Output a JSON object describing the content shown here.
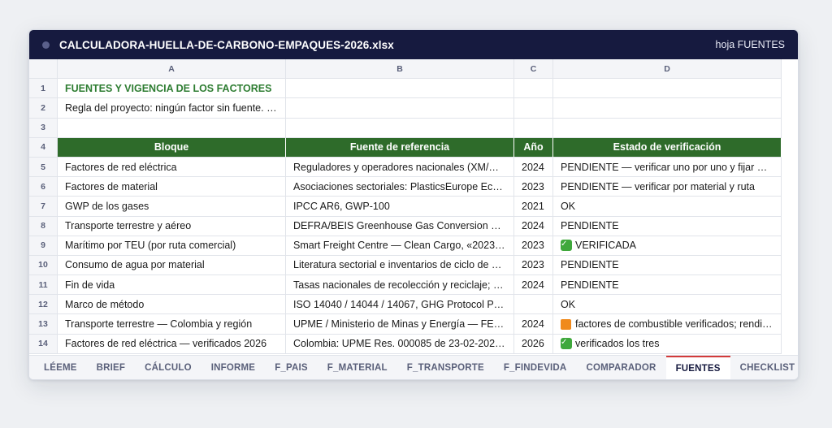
{
  "window": {
    "title": "CALCULADORA-HUELLA-DE-CARBONO-EMPAQUES-2026.xlsx",
    "sheet_label": "hoja FUENTES"
  },
  "columns": [
    "A",
    "B",
    "C",
    "D"
  ],
  "row_numbers": [
    "1",
    "2",
    "3",
    "4",
    "5",
    "6",
    "7",
    "8",
    "9",
    "10",
    "11",
    "12",
    "13",
    "14"
  ],
  "sheet_title": "FUENTES Y VIGENCIA DE LOS FACTORES",
  "project_rule": "Regla del proyecto: ningún factor sin fuente. …",
  "headers": {
    "bloque": "Bloque",
    "fuente": "Fuente de referencia",
    "anio": "Año",
    "estado": "Estado de verificación"
  },
  "rows": [
    {
      "bloque": "Factores de red eléctrica",
      "fuente": "Reguladores y operadores nacionales (XM/…",
      "anio": "2024",
      "estado": "PENDIENTE — verificar uno por uno y fijar …",
      "icon": ""
    },
    {
      "bloque": "Factores de material",
      "fuente": "Asociaciones sectoriales: PlasticsEurope Ec…",
      "anio": "2023",
      "estado": "PENDIENTE — verificar por material y ruta",
      "icon": ""
    },
    {
      "bloque": "GWP de los gases",
      "fuente": "IPCC AR6, GWP-100",
      "anio": "2021",
      "estado": "OK",
      "icon": ""
    },
    {
      "bloque": "Transporte terrestre y aéreo",
      "fuente": "DEFRA/BEIS Greenhouse Gas Conversion …",
      "anio": "2024",
      "estado": "PENDIENTE",
      "icon": ""
    },
    {
      "bloque": "Marítimo por TEU (por ruta comercial)",
      "fuente": "Smart Freight Centre — Clean Cargo, «2023…",
      "anio": "2023",
      "estado": "VERIFICADA",
      "icon": "check-icon"
    },
    {
      "bloque": "Consumo de agua por material",
      "fuente": "Literatura sectorial e inventarios de ciclo de …",
      "anio": "2023",
      "estado": "PENDIENTE",
      "icon": ""
    },
    {
      "bloque": "Fin de vida",
      "fuente": "Tasas nacionales de recolección y reciclaje; …",
      "anio": "2024",
      "estado": "PENDIENTE",
      "icon": ""
    },
    {
      "bloque": "Marco de método",
      "fuente": "ISO 14040 / 14044 / 14067, GHG Protocol P…",
      "anio": "",
      "estado": "OK",
      "icon": ""
    },
    {
      "bloque": "Transporte terrestre — Colombia y región",
      "fuente": "UPME / Ministerio de Minas y Energía — FE…",
      "anio": "2024",
      "estado": "factores de combustible verificados; rendi…",
      "icon": "orange-square-icon"
    },
    {
      "bloque": "Factores de red eléctrica — verificados 2026",
      "fuente": "Colombia: UPME Res. 000085 de 23-02-202…",
      "anio": "2026",
      "estado": "verificados los tres",
      "icon": "check-icon"
    }
  ],
  "tabs": [
    "LÉEME",
    "BRIEF",
    "CÁLCULO",
    "INFORME",
    "F_PAIS",
    "F_MATERIAL",
    "F_TRANSPORTE",
    "F_FINDEVIDA",
    "COMPARADOR",
    "FUENTES",
    "CHECKLIST"
  ],
  "active_tab": "FUENTES",
  "colors": {
    "titlebar": "#161a3f",
    "header_green": "#2e6b2a",
    "title_green": "#2e7d32",
    "active_tab_accent": "#d33b3b"
  }
}
